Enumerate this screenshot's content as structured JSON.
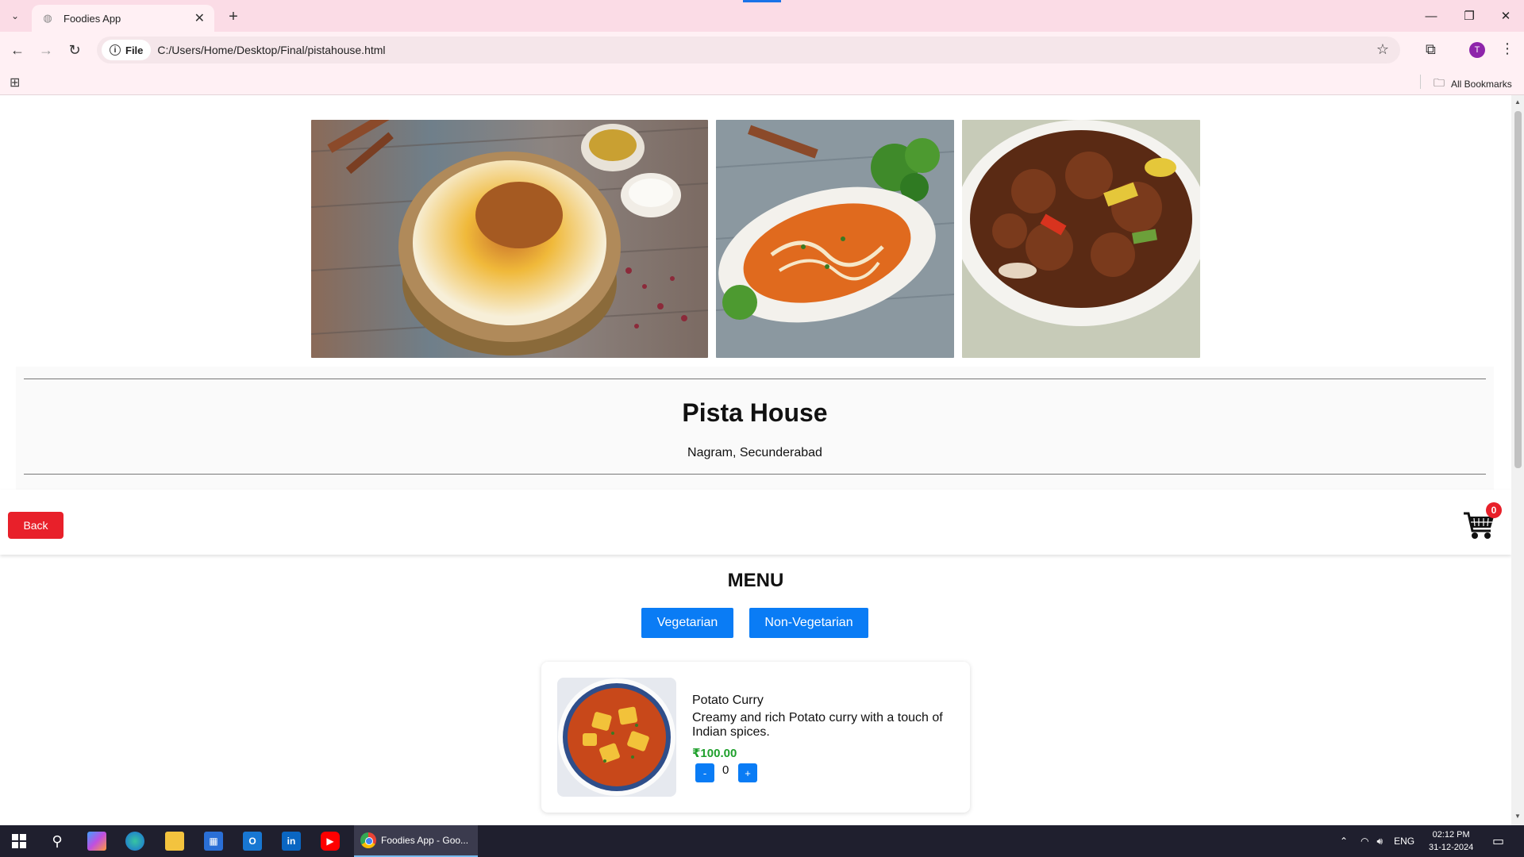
{
  "browser": {
    "tab_title": "Foodies App",
    "site_chip_label": "File",
    "url": "C:/Users/Home/Desktop/Final/pistahouse.html",
    "profile_initial": "T",
    "all_bookmarks": "All Bookmarks",
    "accent_color": "#fbdce6"
  },
  "restaurant": {
    "name": "Pista House",
    "location": "Nagram, Secunderabad"
  },
  "actions": {
    "back_label": "Back",
    "cart_count": "0"
  },
  "menu": {
    "title": "MENU",
    "categories": [
      "Vegetarian",
      "Non-Vegetarian"
    ],
    "items": [
      {
        "name": "Potato Curry",
        "description": "Creamy and rich Potato curry with a touch of Indian spices.",
        "price": "₹100.00",
        "quantity": "0",
        "decrement_label": "-",
        "increment_label": "+"
      }
    ]
  },
  "colors": {
    "back_button": "#e8202a",
    "category_button": "#0a7cf5",
    "price": "#1fa02c"
  },
  "taskbar": {
    "chrome_label": "Foodies App - Goo...",
    "language": "ENG",
    "time": "02:12 PM",
    "date": "31-12-2024"
  }
}
